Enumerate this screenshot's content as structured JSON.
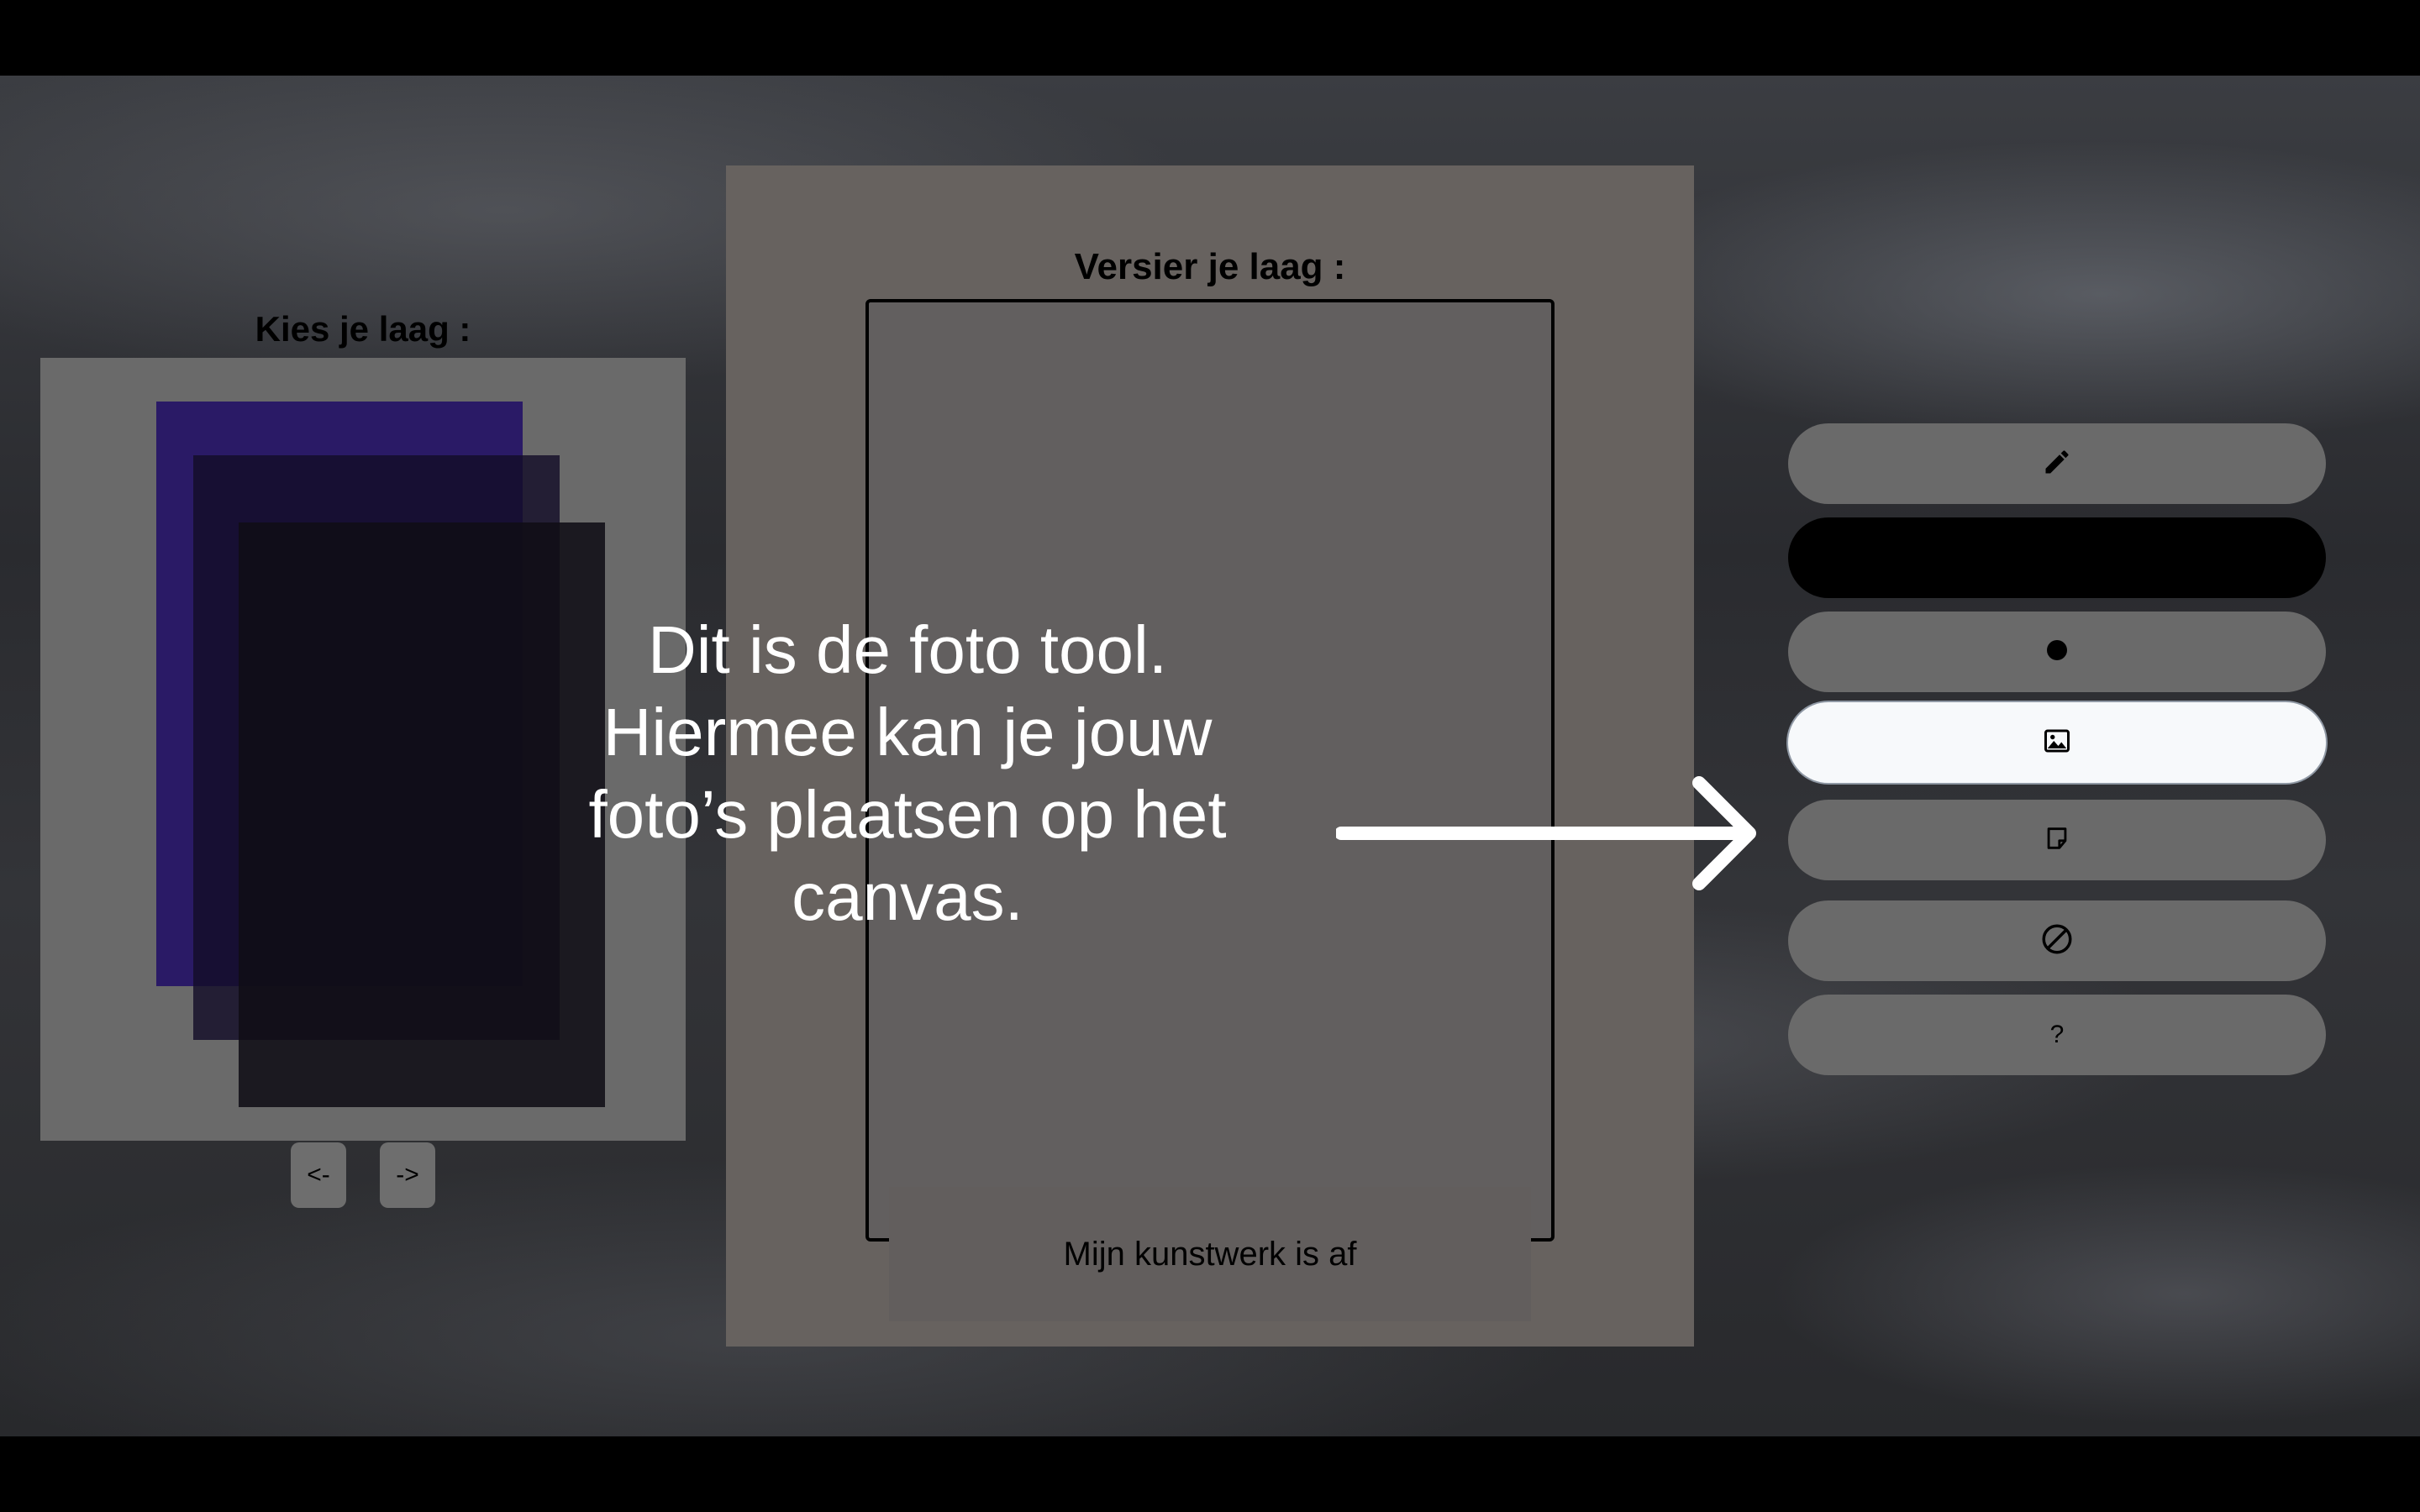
{
  "left_panel": {
    "title": "Kies je laag :",
    "layers": [
      {
        "name": "layer-1",
        "color": "#2a1a66"
      },
      {
        "name": "layer-2",
        "color": "#140e28"
      },
      {
        "name": "layer-3",
        "color": "#100e16"
      }
    ],
    "prev_label": "<-",
    "next_label": "->"
  },
  "editor": {
    "title": "Versier je laag :",
    "done_label": "Mijn kunstwerk is af"
  },
  "toolbar": {
    "tools": [
      {
        "name": "pencil",
        "icon": "pencil-icon"
      },
      {
        "name": "color",
        "icon": "",
        "color": "#000000"
      },
      {
        "name": "brush-size",
        "icon": "dot-icon"
      },
      {
        "name": "photo",
        "icon": "image-icon",
        "active": true
      },
      {
        "name": "sticky-note",
        "icon": "note-icon"
      },
      {
        "name": "clear",
        "icon": "prohibit-icon"
      },
      {
        "name": "help",
        "icon": "question-icon",
        "label": "?"
      }
    ]
  },
  "tutorial": {
    "lines": [
      "Dit is de foto tool.",
      "Hiermee kan je jouw",
      "foto’s plaatsen op het",
      "canvas."
    ]
  }
}
